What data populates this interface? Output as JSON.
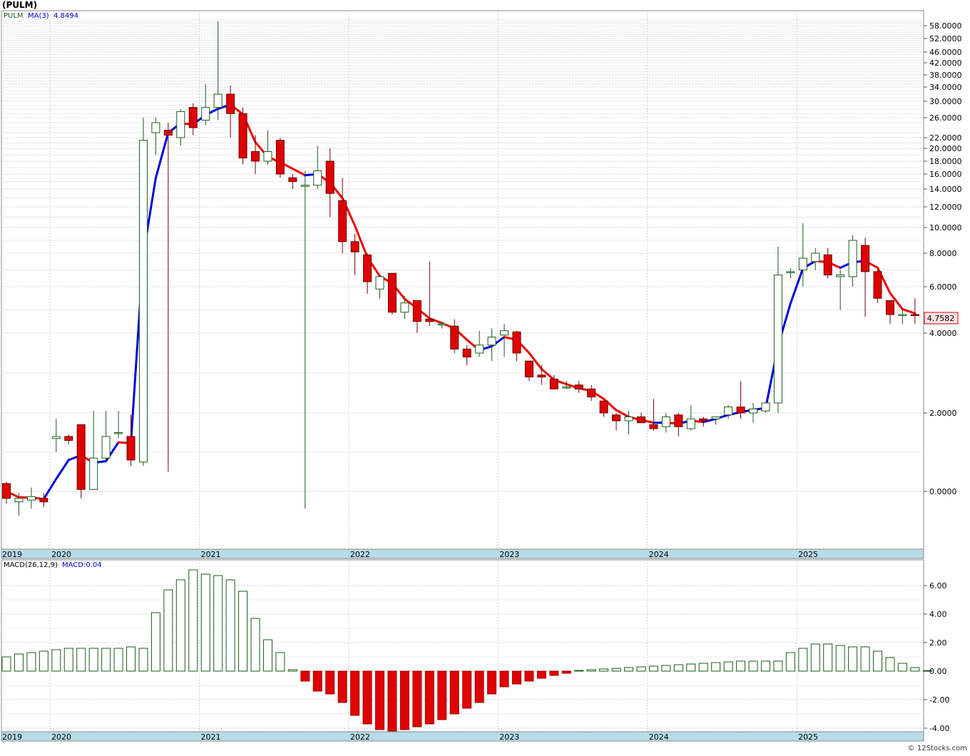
{
  "title": "(PULM)",
  "watermark": "© 12Stocks.com",
  "colors": {
    "up_candle": "#1a5c1a",
    "down_candle": "#e00000",
    "ma_up": "#0000dd",
    "ma_down": "#ee0000",
    "grid": "#d0d0d0",
    "axis_band": "#b8dce8",
    "last_price_bg": "#fbe4e4"
  },
  "chart_data": [
    {
      "type": "candlestick",
      "legend": {
        "symbol": "PULM",
        "ma_label": "MA(3)",
        "ma_value": "4.8494"
      },
      "last_price": "4.7582",
      "y_ticks": [
        "58.0000",
        "52.0000",
        "46.0000",
        "42.0000",
        "38.0000",
        "34.0000",
        "30.0000",
        "26.0000",
        "22.0000",
        "20.0000",
        "18.0000",
        "16.0000",
        "14.0000",
        "12.0000",
        "10.0000",
        "8.0000",
        "6.0000",
        "4.0000",
        "2.0000",
        "0.0000"
      ],
      "y_tick_values": [
        58,
        52,
        46,
        42,
        38,
        34,
        30,
        26,
        22,
        20,
        18,
        16,
        14,
        12,
        10,
        8,
        6,
        4,
        2,
        0
      ],
      "x_labels": [
        "2019",
        "2020",
        "2021",
        "2022",
        "2023",
        "2024",
        "2025"
      ],
      "x_label_index": [
        0,
        4,
        16,
        28,
        40,
        52,
        64
      ],
      "scale": "log-like",
      "candles": [
        [
          0.2,
          0.25,
          -0.35,
          -0.2
        ],
        [
          -0.3,
          -0.05,
          -0.7,
          -0.2
        ],
        [
          -0.25,
          0.1,
          -0.5,
          -0.15
        ],
        [
          -0.2,
          -0.05,
          -0.45,
          -0.3
        ],
        [
          1.35,
          1.85,
          1.0,
          1.4
        ],
        [
          1.4,
          1.45,
          1.2,
          1.3
        ],
        [
          1.7,
          1.7,
          -0.2,
          0.05
        ],
        [
          0.05,
          2.05,
          0.05,
          0.85
        ],
        [
          0.85,
          2.05,
          0.8,
          1.4
        ],
        [
          1.5,
          2.05,
          1.35,
          1.5
        ],
        [
          1.4,
          1.95,
          0.65,
          0.8
        ],
        [
          0.75,
          26.0,
          0.65,
          21.5
        ],
        [
          23.0,
          26.0,
          19.0,
          25.0
        ],
        [
          23.5,
          25.0,
          0.5,
          22.5
        ],
        [
          22.0,
          28.0,
          20.5,
          27.5
        ],
        [
          28.5,
          29.5,
          22.5,
          24.0
        ],
        [
          25.5,
          35.0,
          24.5,
          28.5
        ],
        [
          28.5,
          60.0,
          25.5,
          32.0
        ],
        [
          32.0,
          34.5,
          22.0,
          27.0
        ],
        [
          27.0,
          28.5,
          17.5,
          18.5
        ],
        [
          19.5,
          22.5,
          16.0,
          18.0
        ],
        [
          18.0,
          23.5,
          17.5,
          19.5
        ],
        [
          21.5,
          22.0,
          15.5,
          16.0
        ],
        [
          15.5,
          16.0,
          14.0,
          15.0
        ],
        [
          14.5,
          16.5,
          -0.5,
          14.5
        ],
        [
          14.5,
          20.5,
          14.0,
          16.5
        ],
        [
          18.0,
          20.0,
          11.0,
          13.5
        ],
        [
          12.7,
          15.5,
          8.0,
          8.9
        ],
        [
          8.9,
          9.5,
          6.7,
          8.1
        ],
        [
          7.9,
          8.0,
          5.7,
          6.3
        ],
        [
          5.9,
          6.6,
          5.5,
          6.6
        ],
        [
          6.8,
          6.8,
          4.8,
          4.9
        ],
        [
          4.9,
          5.6,
          4.6,
          5.3
        ],
        [
          5.4,
          5.4,
          4.0,
          4.5
        ],
        [
          4.6,
          7.5,
          4.3,
          4.5
        ],
        [
          4.4,
          4.5,
          4.2,
          4.4
        ],
        [
          4.3,
          4.6,
          3.5,
          3.6
        ],
        [
          3.6,
          3.7,
          3.2,
          3.4
        ],
        [
          3.5,
          4.1,
          3.4,
          3.7
        ],
        [
          3.7,
          4.2,
          3.3,
          3.9
        ],
        [
          3.95,
          4.4,
          3.4,
          4.1
        ],
        [
          4.05,
          4.1,
          3.3,
          3.5
        ],
        [
          3.3,
          3.3,
          2.8,
          2.9
        ],
        [
          2.95,
          3.2,
          2.7,
          2.9
        ],
        [
          2.85,
          2.95,
          2.6,
          2.6
        ],
        [
          2.65,
          2.8,
          2.6,
          2.65
        ],
        [
          2.7,
          2.8,
          2.5,
          2.6
        ],
        [
          2.6,
          2.7,
          2.3,
          2.4
        ],
        [
          2.3,
          2.3,
          1.9,
          2.0
        ],
        [
          1.95,
          2.0,
          1.55,
          1.8
        ],
        [
          1.8,
          2.05,
          1.45,
          1.9
        ],
        [
          1.9,
          2.0,
          1.75,
          1.75
        ],
        [
          1.7,
          2.35,
          1.55,
          1.6
        ],
        [
          1.65,
          2.0,
          1.5,
          1.9
        ],
        [
          1.95,
          2.0,
          1.4,
          1.65
        ],
        [
          1.6,
          2.2,
          1.55,
          1.85
        ],
        [
          1.85,
          1.9,
          1.65,
          1.8
        ],
        [
          1.85,
          1.9,
          1.7,
          1.9
        ],
        [
          1.95,
          2.2,
          1.85,
          2.15
        ],
        [
          2.15,
          2.8,
          1.85,
          2.0
        ],
        [
          2.0,
          2.25,
          1.75,
          2.1
        ],
        [
          2.05,
          2.25,
          2.0,
          2.25
        ],
        [
          2.25,
          8.5,
          2.0,
          6.7
        ],
        [
          6.9,
          7.1,
          6.5,
          6.9
        ],
        [
          7.0,
          10.4,
          6.0,
          7.7
        ],
        [
          7.5,
          8.4,
          7.0,
          8.0
        ],
        [
          7.9,
          8.4,
          6.5,
          6.7
        ],
        [
          6.6,
          7.0,
          5.0,
          6.7
        ],
        [
          6.6,
          9.4,
          6.0,
          9.0
        ],
        [
          8.6,
          9.2,
          4.7,
          6.9
        ],
        [
          6.9,
          7.0,
          5.3,
          5.5
        ],
        [
          5.4,
          5.4,
          4.4,
          4.8
        ],
        [
          4.8,
          5.0,
          4.4,
          4.8
        ],
        [
          4.8,
          5.5,
          4.4,
          4.76
        ]
      ],
      "ma3": [
        0.0,
        -0.17,
        -0.18,
        -0.22,
        0.32,
        0.8,
        0.92,
        0.73,
        0.77,
        1.25,
        1.23,
        7.93,
        15.47,
        23.0,
        24.83,
        24.67,
        26.67,
        28.17,
        29.17,
        26.83,
        21.17,
        18.67,
        17.83,
        16.83,
        15.83,
        16.0,
        14.83,
        12.97,
        10.17,
        7.77,
        6.63,
        6.2,
        5.47,
        5.07,
        4.63,
        4.43,
        4.2,
        3.83,
        3.57,
        3.67,
        3.9,
        3.83,
        3.5,
        3.1,
        2.83,
        2.72,
        2.62,
        2.55,
        2.35,
        2.07,
        1.9,
        1.82,
        1.75,
        1.75,
        1.73,
        1.8,
        1.77,
        1.85,
        1.95,
        2.02,
        2.08,
        2.12,
        3.68,
        5.28,
        7.1,
        7.53,
        7.47,
        7.13,
        7.47,
        7.53,
        7.13,
        5.73,
        5.03,
        4.85
      ]
    },
    {
      "type": "bar",
      "legend": {
        "label": "MACD(26,12,9)",
        "value_label": "MACD:0.04"
      },
      "y_ticks": [
        "6.00",
        "4.00",
        "2.00",
        "0.00",
        "-2.00",
        "-4.00"
      ],
      "y_tick_values": [
        6,
        4,
        2,
        0,
        -2,
        -4
      ],
      "x_labels": [
        "2019",
        "2020",
        "2021",
        "2022",
        "2023",
        "2024",
        "2025"
      ],
      "values": [
        1.0,
        1.2,
        1.3,
        1.4,
        1.5,
        1.6,
        1.6,
        1.6,
        1.6,
        1.6,
        1.7,
        1.6,
        4.1,
        5.7,
        6.4,
        7.1,
        6.8,
        6.7,
        6.4,
        5.6,
        3.7,
        2.2,
        1.3,
        0.1,
        -0.7,
        -1.4,
        -1.6,
        -2.2,
        -3.1,
        -3.7,
        -4.1,
        -4.2,
        -4.1,
        -3.9,
        -3.7,
        -3.4,
        -3.0,
        -2.6,
        -2.2,
        -1.6,
        -1.1,
        -0.9,
        -0.7,
        -0.5,
        -0.3,
        -0.15,
        0.05,
        0.1,
        0.15,
        0.2,
        0.25,
        0.3,
        0.35,
        0.4,
        0.45,
        0.5,
        0.55,
        0.6,
        0.65,
        0.7,
        0.7,
        0.7,
        0.7,
        1.3,
        1.6,
        1.9,
        1.9,
        1.8,
        1.7,
        1.7,
        1.4,
        0.95,
        0.55,
        0.25,
        0.04
      ]
    }
  ]
}
